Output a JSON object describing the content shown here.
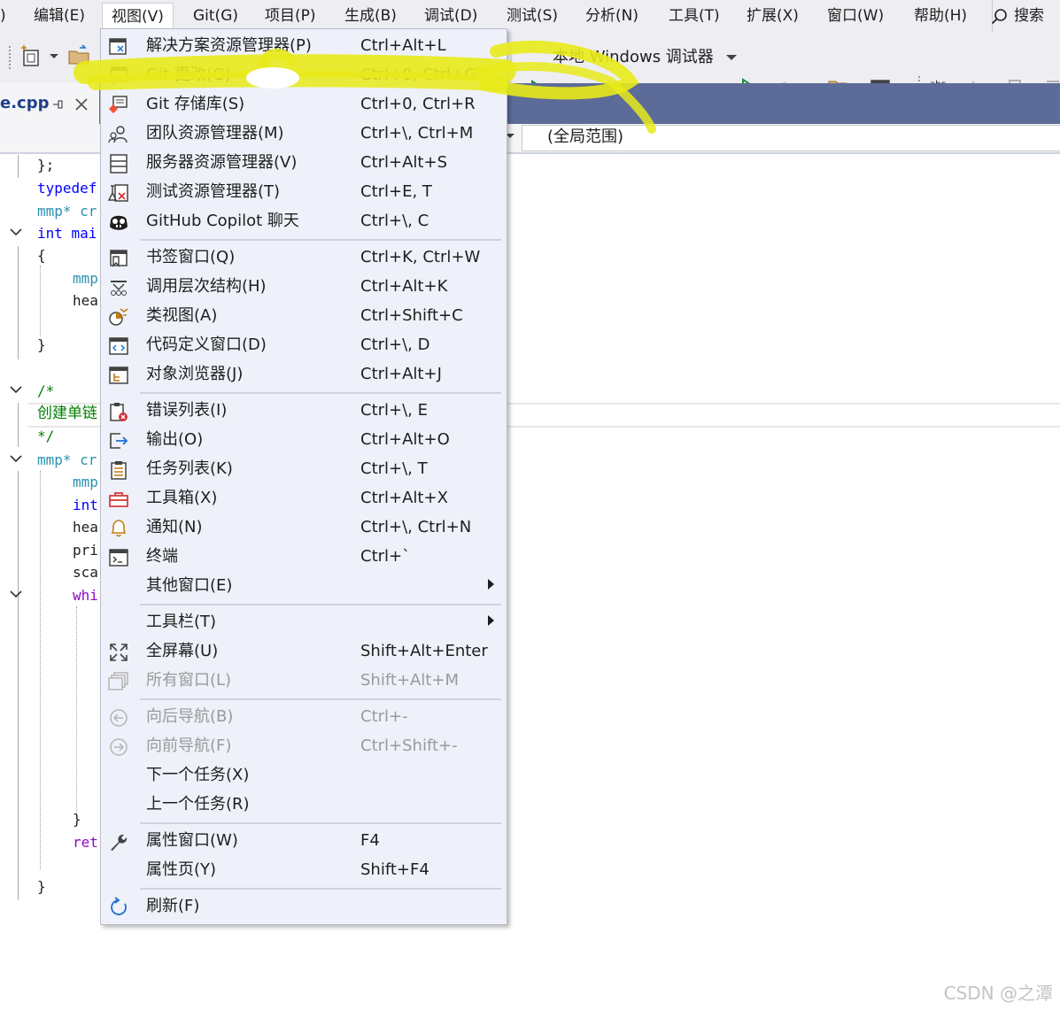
{
  "menubar": {
    "items": [
      {
        "label": ")"
      },
      {
        "label": "编辑(E)"
      },
      {
        "label": "视图(V)"
      },
      {
        "label": "Git(G)"
      },
      {
        "label": "项目(P)"
      },
      {
        "label": "生成(B)"
      },
      {
        "label": "调试(D)"
      },
      {
        "label": "测试(S)"
      },
      {
        "label": "分析(N)"
      },
      {
        "label": "工具(T)"
      },
      {
        "label": "扩展(X)"
      },
      {
        "label": "窗口(W)"
      },
      {
        "label": "帮助(H)"
      }
    ],
    "search_label": "搜索"
  },
  "toolbar": {
    "run_label": "本地 Windows 调试器"
  },
  "editor": {
    "tab_label": "e.cpp",
    "scope_label": "(全局范围)",
    "lines": [
      {
        "text": "};",
        "color": "#1e1e1e"
      },
      {
        "text": "typedef",
        "color": "#0000ff"
      },
      {
        "text": "mmp* cr",
        "color": "#2b91af"
      },
      {
        "text": "int mai",
        "color": "#0000ff"
      },
      {
        "text": "{",
        "color": "#1e1e1e"
      },
      {
        "text": "mmp",
        "color": "#2b91af"
      },
      {
        "text": "hea",
        "color": "#1e1e1e"
      },
      {
        "text": "}",
        "color": "#1e1e1e"
      },
      {
        "text": "/*",
        "color": "#008000"
      },
      {
        "text": "创建单链",
        "color": "#008000"
      },
      {
        "text": "*/",
        "color": "#008000"
      },
      {
        "text": "mmp* cr",
        "color": "#2b91af"
      },
      {
        "text": "mmp",
        "color": "#2b91af"
      },
      {
        "text": "int",
        "color": "#0000ff"
      },
      {
        "text": "hea",
        "color": "#1e1e1e"
      },
      {
        "text": "pri",
        "color": "#1e1e1e"
      },
      {
        "text": "sca",
        "color": "#1e1e1e"
      },
      {
        "text": "whi",
        "color": "#8f08c4"
      },
      {
        "text": "}",
        "color": "#1e1e1e"
      },
      {
        "text": "ret",
        "color": "#8f08c4"
      },
      {
        "text": "}",
        "color": "#1e1e1e"
      }
    ]
  },
  "view_menu": {
    "items": [
      {
        "label": "解决方案资源管理器(P)",
        "shortcut": "Ctrl+Alt+L",
        "icon": "solution-explorer-icon"
      },
      {
        "label": "Git 更改(G)",
        "shortcut": "Ctrl+0, Ctrl+G",
        "icon": "git-changes-icon"
      },
      {
        "label": "Git 存储库(S)",
        "shortcut": "Ctrl+0, Ctrl+R",
        "icon": "git-repository-icon"
      },
      {
        "label": "团队资源管理器(M)",
        "shortcut": "Ctrl+\\, Ctrl+M",
        "icon": "team-explorer-icon"
      },
      {
        "label": "服务器资源管理器(V)",
        "shortcut": "Ctrl+Alt+S",
        "icon": "server-explorer-icon"
      },
      {
        "label": "测试资源管理器(T)",
        "shortcut": "Ctrl+E, T",
        "icon": "test-explorer-icon"
      },
      {
        "label": "GitHub Copilot 聊天",
        "shortcut": "Ctrl+\\, C",
        "icon": "copilot-icon"
      },
      {
        "label": "书签窗口(Q)",
        "shortcut": "Ctrl+K, Ctrl+W",
        "icon": "bookmark-window-icon"
      },
      {
        "label": "调用层次结构(H)",
        "shortcut": "Ctrl+Alt+K",
        "icon": "call-hierarchy-icon"
      },
      {
        "label": "类视图(A)",
        "shortcut": "Ctrl+Shift+C",
        "icon": "class-view-icon"
      },
      {
        "label": "代码定义窗口(D)",
        "shortcut": "Ctrl+\\, D",
        "icon": "code-definition-icon"
      },
      {
        "label": "对象浏览器(J)",
        "shortcut": "Ctrl+Alt+J",
        "icon": "object-browser-icon"
      },
      {
        "label": "错误列表(I)",
        "shortcut": "Ctrl+\\, E",
        "icon": "error-list-icon"
      },
      {
        "label": "输出(O)",
        "shortcut": "Ctrl+Alt+O",
        "icon": "output-icon"
      },
      {
        "label": "任务列表(K)",
        "shortcut": "Ctrl+\\, T",
        "icon": "task-list-icon"
      },
      {
        "label": "工具箱(X)",
        "shortcut": "Ctrl+Alt+X",
        "icon": "toolbox-icon"
      },
      {
        "label": "通知(N)",
        "shortcut": "Ctrl+\\, Ctrl+N",
        "icon": "bell-icon"
      },
      {
        "label": "终端",
        "shortcut": "Ctrl+`",
        "icon": "terminal-icon"
      },
      {
        "label": "其他窗口(E)",
        "shortcut": "",
        "icon": ""
      },
      {
        "label": "工具栏(T)",
        "shortcut": "",
        "icon": ""
      },
      {
        "label": "全屏幕(U)",
        "shortcut": "Shift+Alt+Enter",
        "icon": "fullscreen-icon"
      },
      {
        "label": "所有窗口(L)",
        "shortcut": "Shift+Alt+M",
        "icon": "all-windows-icon"
      },
      {
        "label": "向后导航(B)",
        "shortcut": "Ctrl+-",
        "icon": "navigate-back-icon"
      },
      {
        "label": "向前导航(F)",
        "shortcut": "Ctrl+Shift+-",
        "icon": "navigate-forward-icon"
      },
      {
        "label": "下一个任务(X)",
        "shortcut": "",
        "icon": ""
      },
      {
        "label": "上一个任务(R)",
        "shortcut": "",
        "icon": ""
      },
      {
        "label": "属性窗口(W)",
        "shortcut": "F4",
        "icon": "wrench-icon"
      },
      {
        "label": "属性页(Y)",
        "shortcut": "Shift+F4",
        "icon": ""
      },
      {
        "label": "刷新(F)",
        "shortcut": "",
        "icon": "refresh-icon"
      }
    ]
  },
  "watermark": "CSDN @之潭"
}
